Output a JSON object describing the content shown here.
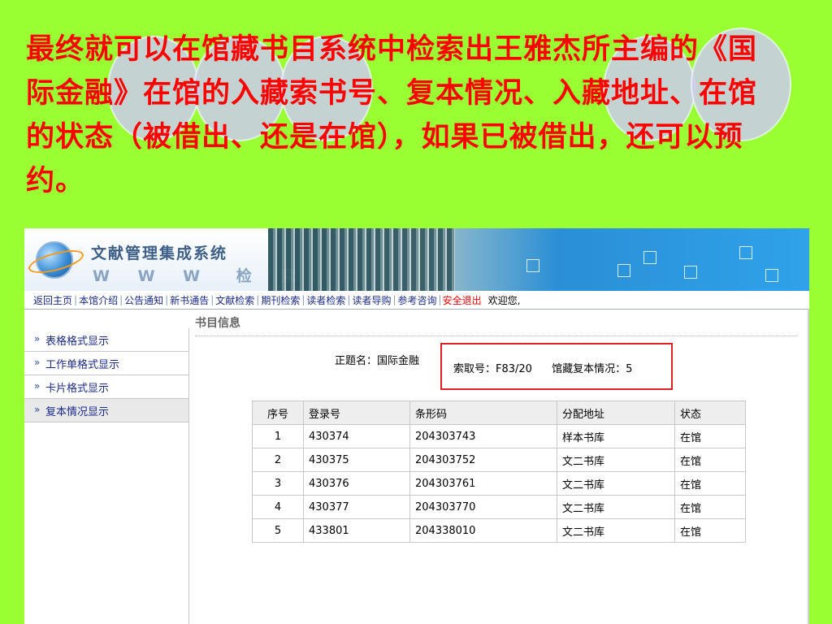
{
  "slide": {
    "heading": "最终就可以在馆藏书目系统中检索出王雅杰所主编的《国际金融》在馆的入藏索书号、复本情况、入藏地址、在馆的状态（被借出、还是在馆），如果已被借出，还可以预约。",
    "text_color": "#ff0000",
    "background_color": "#99ff33"
  },
  "banner": {
    "title": "文献管理集成系统",
    "subtitle_left": "W W W",
    "subtitle_right": "检 索"
  },
  "nav": {
    "items": [
      "返回主页",
      "本馆介绍",
      "公告通知",
      "新书通告",
      "文献检索",
      "期刊检索",
      "读者检索",
      "读者导购",
      "参考咨询"
    ],
    "exit_label": "安全退出",
    "welcome": "欢迎您,"
  },
  "sidebar": {
    "items": [
      {
        "label": "表格格式显示",
        "icon": "double-chevron-icon"
      },
      {
        "label": "工作单格式显示",
        "icon": "double-chevron-icon"
      },
      {
        "label": "卡片格式显示",
        "icon": "double-chevron-icon"
      },
      {
        "label": "复本情况显示",
        "icon": "double-chevron-icon"
      }
    ],
    "active_index": 3
  },
  "main": {
    "section_title": "书目信息",
    "title_label": "正题名：国际金融",
    "call_number": "索取号：F83/20",
    "copies_info": "馆藏复本情况：5",
    "table": {
      "headers": [
        "序号",
        "登录号",
        "条形码",
        "分配地址",
        "状态"
      ],
      "rows": [
        [
          "1",
          "430374",
          "204303743",
          "样本书库",
          "在馆"
        ],
        [
          "2",
          "430375",
          "204303752",
          "文二书库",
          "在馆"
        ],
        [
          "3",
          "430376",
          "204303761",
          "文二书库",
          "在馆"
        ],
        [
          "4",
          "430377",
          "204303770",
          "文二书库",
          "在馆"
        ],
        [
          "5",
          "433801",
          "204338010",
          "文二书库",
          "在馆"
        ]
      ]
    }
  }
}
